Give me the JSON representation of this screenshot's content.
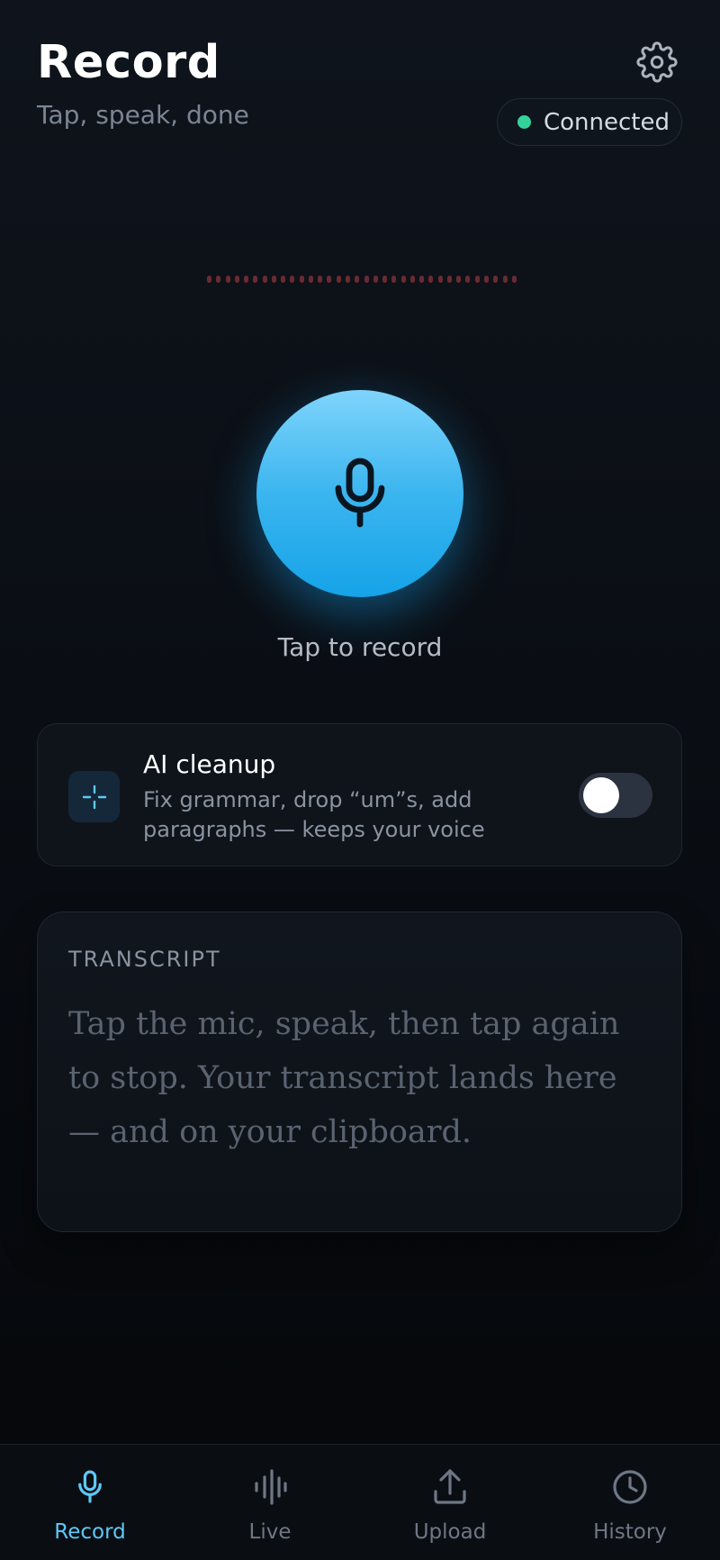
{
  "header": {
    "title": "Record",
    "subtitle": "Tap, speak, done"
  },
  "status": {
    "label": "Connected",
    "color": "#34d399"
  },
  "recorder": {
    "label": "Tap to record",
    "accent": "#15a3e8"
  },
  "ai_cleanup": {
    "title": "AI cleanup",
    "description": "Fix grammar, drop “um”s, add paragraphs — keeps your voice",
    "enabled": false
  },
  "transcript": {
    "label": "TRANSCRIPT",
    "placeholder": "Tap the mic, speak, then tap again to stop. Your transcript lands here — and on your clipboard."
  },
  "tabs": [
    {
      "label": "Record",
      "icon": "mic-icon",
      "active": true
    },
    {
      "label": "Live",
      "icon": "waveform-icon",
      "active": false
    },
    {
      "label": "Upload",
      "icon": "upload-icon",
      "active": false
    },
    {
      "label": "History",
      "icon": "clock-icon",
      "active": false
    }
  ],
  "colors": {
    "active_tab": "#5ec8f7",
    "inactive_tab": "#6e7785"
  }
}
